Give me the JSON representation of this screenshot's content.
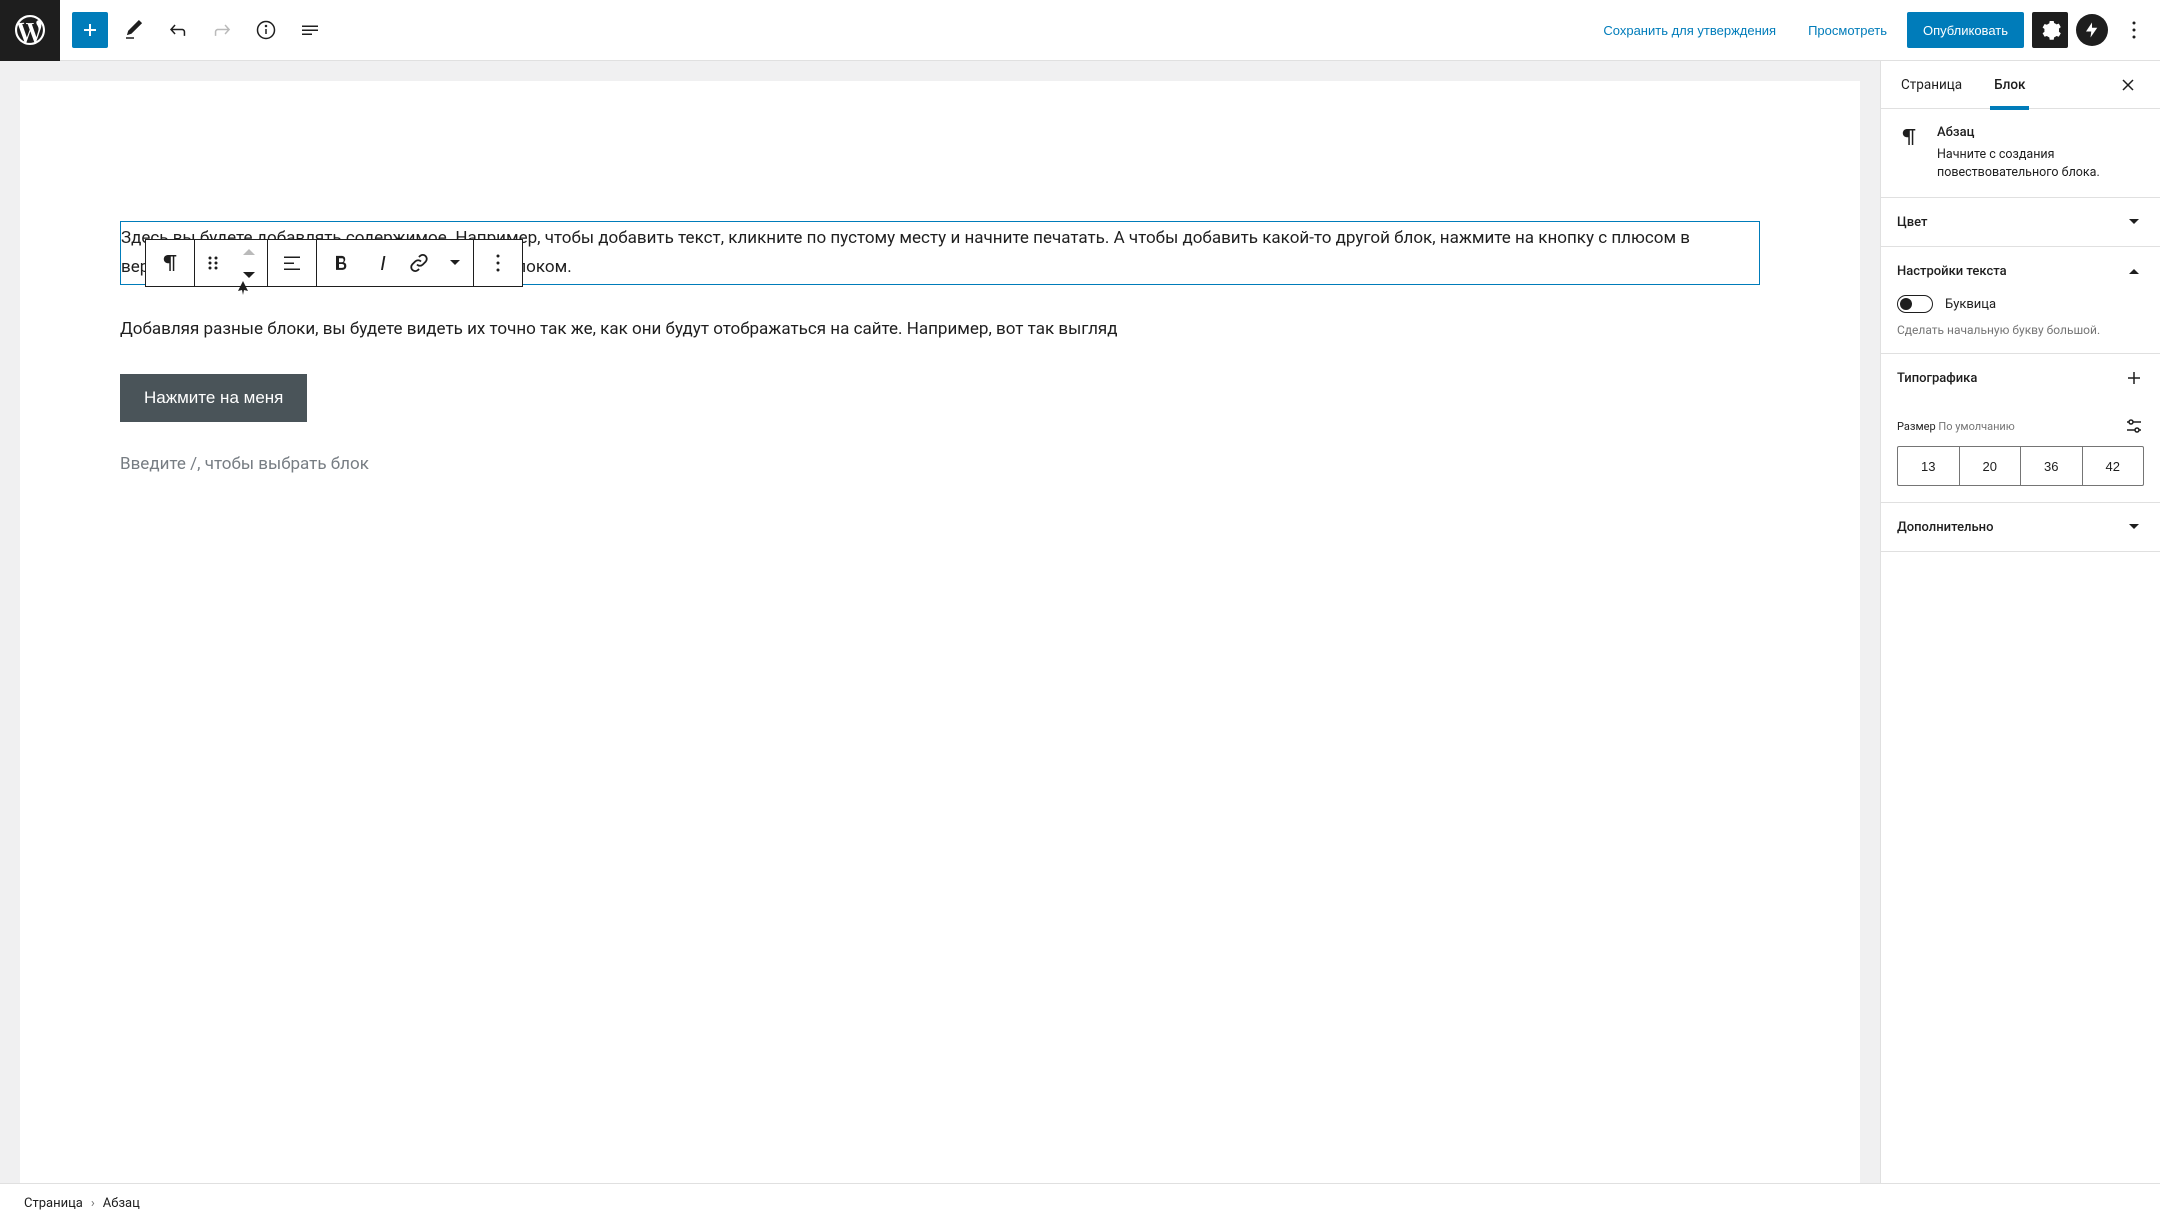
{
  "toolbar": {
    "save": "Сохранить для утверждения",
    "preview": "Просмотреть",
    "publish": "Опубликовать"
  },
  "content": {
    "para1": "Здесь вы будете добавлять содержимое. Например, чтобы добавить текст, кликните по пустому месту и начните печатать. А чтобы добавить какой-то другой блок, нажмите на кнопку с плюсом в верхнем левом углу или справа под последним блоком.",
    "para2": "Добавляя разные блоки, вы будете видеть их точно так же, как они будут отображаться на сайте. Например, вот так выгляд",
    "button": "Нажмите на меня",
    "placeholder": "Введите /, чтобы выбрать блок"
  },
  "sidebar": {
    "tab_page": "Страница",
    "tab_block": "Блок",
    "block_title": "Абзац",
    "block_desc": "Начните с создания повествовательного блока.",
    "color": "Цвет",
    "text_settings": "Настройки текста",
    "dropcap": "Буквица",
    "dropcap_help": "Сделать начальную букву большой.",
    "typography": "Типографика",
    "size_label": "Размер",
    "size_default": "По умолчанию",
    "sizes": [
      "13",
      "20",
      "36",
      "42"
    ],
    "advanced": "Дополнительно"
  },
  "footer": {
    "crumb1": "Страница",
    "crumb2": "Абзац"
  }
}
